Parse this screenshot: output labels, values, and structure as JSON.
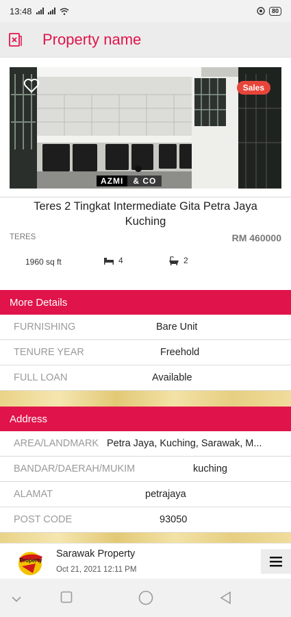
{
  "status_bar": {
    "time": "13:48",
    "battery": "80",
    "icons": [
      "signal-icon",
      "signal-icon",
      "wifi-icon",
      "alarm-icon",
      "battery-icon"
    ]
  },
  "header": {
    "title": "Property name",
    "accent_color": "#e0144a"
  },
  "listing": {
    "badge": "Sales",
    "badge_color": "#e8453a",
    "watermark_a": "AZMI",
    "watermark_b": "& CO",
    "title": "Teres 2 Tingkat Intermediate Gita Petra Jaya Kuching",
    "type": "TERES",
    "price": "RM 460000",
    "size": "1960 sq ft",
    "bedrooms": "4",
    "bathrooms": "2"
  },
  "more_details": {
    "heading": "More Details",
    "rows": [
      {
        "label": "FURNISHING",
        "value": "Bare Unit"
      },
      {
        "label": "TENURE YEAR",
        "value": "Freehold"
      },
      {
        "label": "FULL LOAN",
        "value": "Available"
      }
    ]
  },
  "address": {
    "heading": "Address",
    "rows": [
      {
        "label": "AREA/LANDMARK",
        "value": "Petra Jaya, Kuching, Sarawak, M..."
      },
      {
        "label": "BANDAR/DAERAH/MUKIM",
        "value": "kuching"
      },
      {
        "label": "ALAMAT",
        "value": "petrajaya"
      },
      {
        "label": "POST CODE",
        "value": "93050"
      }
    ]
  },
  "footer": {
    "brand": "Sarawak Property",
    "date": "Oct 21, 2021 12:11 PM"
  },
  "nav": [
    "back-chevron-icon",
    "recents-icon",
    "home-icon",
    "back-icon"
  ]
}
